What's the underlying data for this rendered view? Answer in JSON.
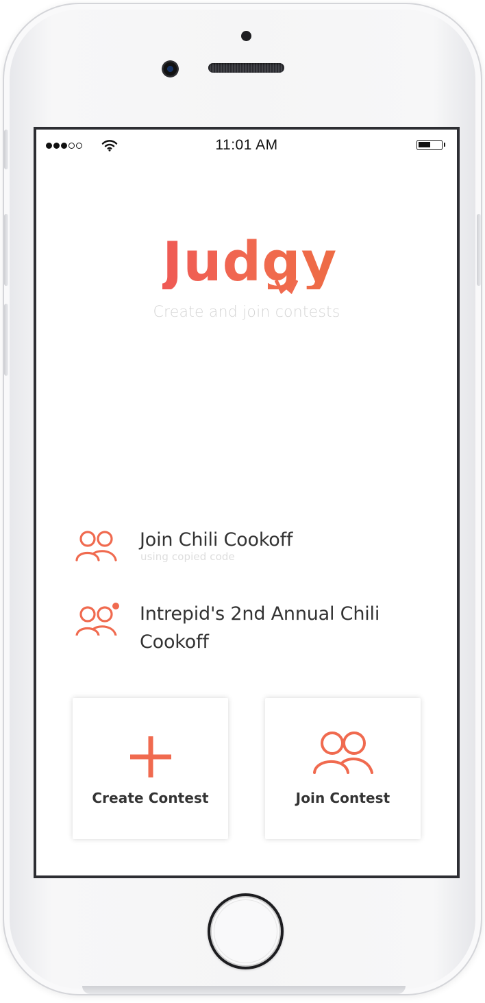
{
  "status_bar": {
    "time": "11:01 AM",
    "signal_strength": 3,
    "signal_total": 5,
    "battery_level": 0.45
  },
  "brand": {
    "name": "Judgy",
    "tagline": "Create and join contests",
    "accent": "#f06a4f"
  },
  "recent_contests": [
    {
      "title": "Join Chili Cookoff",
      "subtitle": "using copied code",
      "icon": "group-icon",
      "has_notification": false
    },
    {
      "title": "Intrepid's  2nd Annual Chili Cookoff",
      "subtitle": "",
      "icon": "group-icon",
      "has_notification": true
    }
  ],
  "actions": {
    "create": {
      "label": "Create Contest",
      "icon": "plus-icon"
    },
    "join": {
      "label": "Join Contest",
      "icon": "group-icon"
    }
  },
  "colors": {
    "accent": "#f06a4f",
    "text_dark": "#333333",
    "text_muted": "#d5d5d5",
    "device_frame": "#f5f5f6"
  }
}
